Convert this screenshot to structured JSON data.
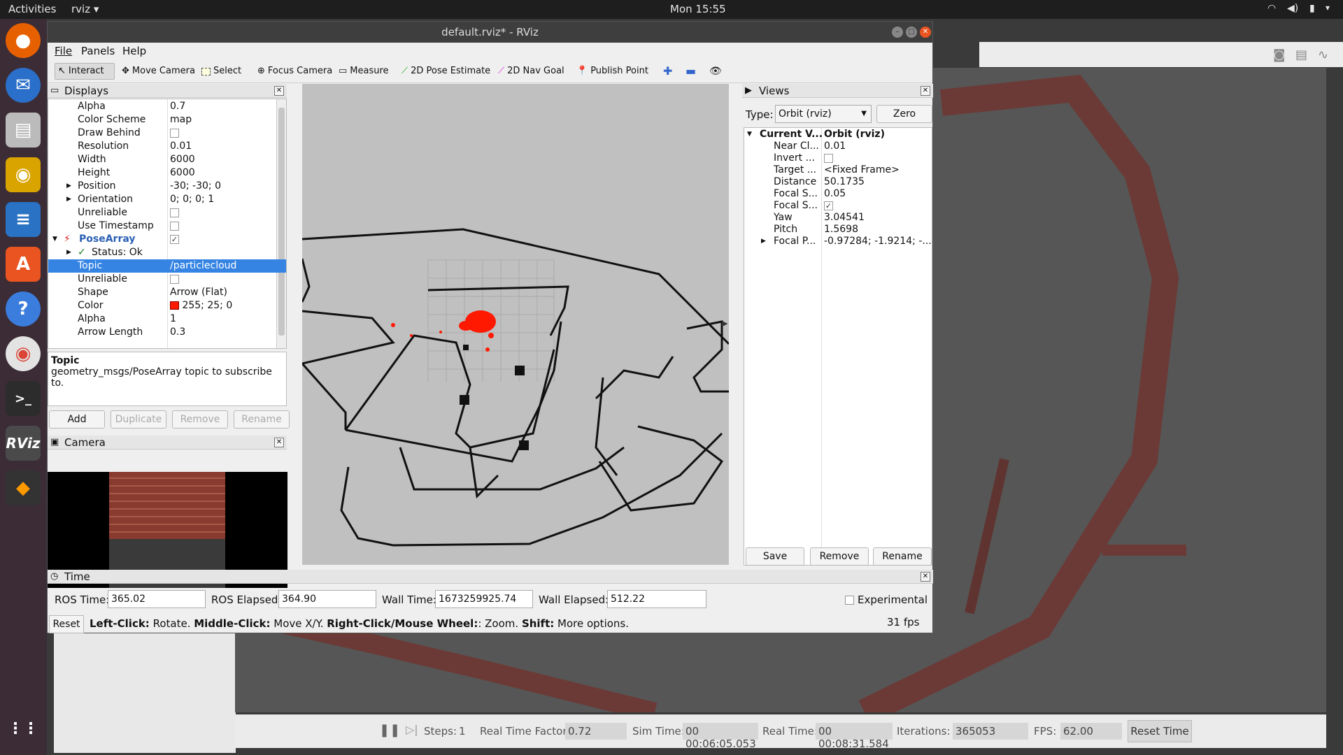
{
  "topbar": {
    "activities": "Activities",
    "app": "rviz ▾",
    "clock": "Mon 15:55"
  },
  "window": {
    "title": "default.rviz* - RViz"
  },
  "menu": {
    "file": "File",
    "panels": "Panels",
    "help": "Help"
  },
  "toolbar": {
    "interact": "Interact",
    "move_camera": "Move Camera",
    "select": "Select",
    "focus_camera": "Focus Camera",
    "measure": "Measure",
    "pose_estimate": "2D Pose Estimate",
    "nav_goal": "2D Nav Goal",
    "publish_point": "Publish Point"
  },
  "displays": {
    "title": "Displays",
    "rows": [
      {
        "k": "Alpha",
        "v": "0.7"
      },
      {
        "k": "Color Scheme",
        "v": "map"
      },
      {
        "k": "Draw Behind",
        "v": ""
      },
      {
        "k": "Resolution",
        "v": "0.01"
      },
      {
        "k": "Width",
        "v": "6000"
      },
      {
        "k": "Height",
        "v": "6000"
      },
      {
        "k": "Position",
        "v": "-30; -30; 0"
      },
      {
        "k": "Orientation",
        "v": "0; 0; 0; 1"
      },
      {
        "k": "Unreliable",
        "v": ""
      },
      {
        "k": "Use Timestamp",
        "v": ""
      },
      {
        "k": "PoseArray",
        "v": ""
      },
      {
        "k": "Status: Ok",
        "v": ""
      },
      {
        "k": "Topic",
        "v": "/particlecloud"
      },
      {
        "k": "Unreliable",
        "v": ""
      },
      {
        "k": "Shape",
        "v": "Arrow (Flat)"
      },
      {
        "k": "Color",
        "v": "255; 25; 0"
      },
      {
        "k": "Alpha",
        "v": "1"
      },
      {
        "k": "Arrow Length",
        "v": "0.3"
      }
    ],
    "help_title": "Topic",
    "help_text": "geometry_msgs/PoseArray topic to subscribe to.",
    "buttons": {
      "add": "Add",
      "duplicate": "Duplicate",
      "remove": "Remove",
      "rename": "Rename"
    }
  },
  "camera": {
    "title": "Camera"
  },
  "views": {
    "title": "Views",
    "type_label": "Type:",
    "type_value": "Orbit (rviz)",
    "zero": "Zero",
    "rows": [
      {
        "k": "Current V...",
        "v": "Orbit (rviz)"
      },
      {
        "k": "Near Cl...",
        "v": "0.01"
      },
      {
        "k": "Invert ...",
        "v": ""
      },
      {
        "k": "Target ...",
        "v": "<Fixed Frame>"
      },
      {
        "k": "Distance",
        "v": "50.1735"
      },
      {
        "k": "Focal S...",
        "v": "0.05"
      },
      {
        "k": "Focal S...",
        "v": ""
      },
      {
        "k": "Yaw",
        "v": "3.04541"
      },
      {
        "k": "Pitch",
        "v": "1.5698"
      },
      {
        "k": "Focal P...",
        "v": "-0.97284; -1.9214; -..."
      }
    ],
    "buttons": {
      "save": "Save",
      "remove": "Remove",
      "rename": "Rename"
    }
  },
  "time": {
    "title": "Time",
    "ros_time_label": "ROS Time:",
    "ros_time": "365.02",
    "ros_elapsed_label": "ROS Elapsed:",
    "ros_elapsed": "364.90",
    "wall_time_label": "Wall Time:",
    "wall_time": "1673259925.74",
    "wall_elapsed_label": "Wall Elapsed:",
    "wall_elapsed": "512.22",
    "experimental": "Experimental",
    "reset": "Reset",
    "hint_left": "Left-Click:",
    "hint_left_t": " Rotate. ",
    "hint_mid": "Middle-Click:",
    "hint_mid_t": " Move X/Y. ",
    "hint_right": "Right-Click/Mouse Wheel:",
    "hint_right_t": ": Zoom. ",
    "hint_shift": "Shift:",
    "hint_shift_t": " More options.",
    "fps": "31 fps"
  },
  "gazebo": {
    "steps_label": "Steps:",
    "steps": "1",
    "rtf_label": "Real Time Factor:",
    "rtf": "0.72",
    "sim_label": "Sim Time:",
    "sim": "00 00:06:05.053",
    "real_label": "Real Time:",
    "real": "00 00:08:31.584",
    "iter_label": "Iterations:",
    "iter": "365053",
    "fps_label": "FPS:",
    "fps": "62.00",
    "reset_time": "Reset Time"
  },
  "colors": {
    "accent": "#3584e4",
    "particle": "#ff1900",
    "dock": "#3b2c36"
  }
}
